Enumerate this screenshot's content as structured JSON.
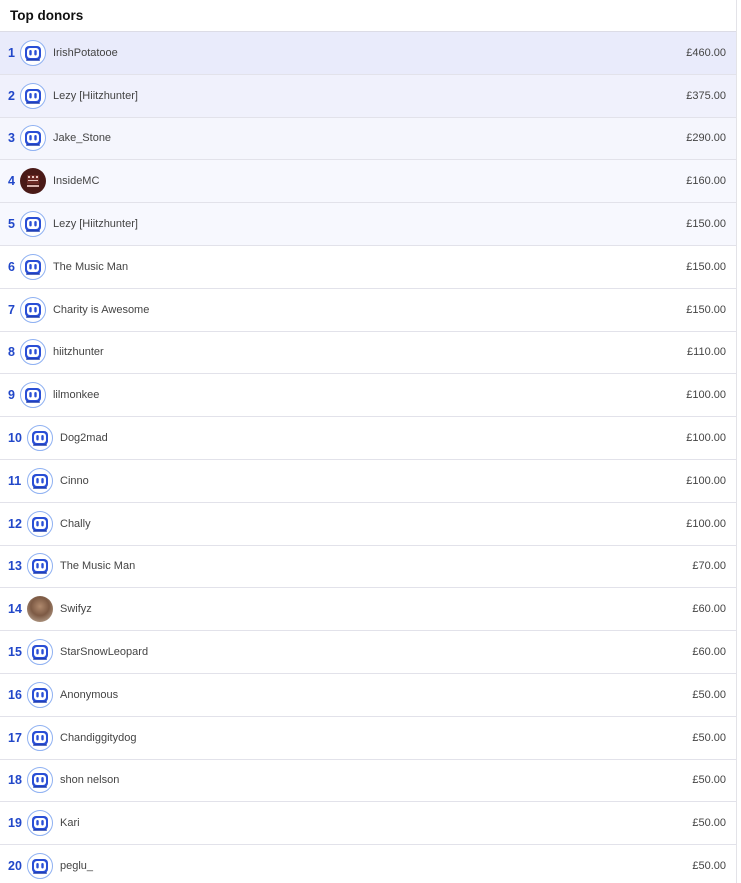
{
  "header": {
    "title": "Top donors"
  },
  "donors": [
    {
      "rank": "1",
      "name": "IrishPotatooe",
      "amount": "£460.00",
      "avatar": "robot-icon"
    },
    {
      "rank": "2",
      "name": "Lezy [Hiitzhunter]",
      "amount": "£375.00",
      "avatar": "robot-icon"
    },
    {
      "rank": "3",
      "name": "Jake_Stone",
      "amount": "£290.00",
      "avatar": "robot-icon"
    },
    {
      "rank": "4",
      "name": "InsideMC",
      "amount": "£160.00",
      "avatar": "pixel-logo-icon"
    },
    {
      "rank": "5",
      "name": "Lezy [Hiitzhunter]",
      "amount": "£150.00",
      "avatar": "robot-icon"
    },
    {
      "rank": "6",
      "name": "The Music Man",
      "amount": "£150.00",
      "avatar": "robot-icon"
    },
    {
      "rank": "7",
      "name": "Charity is Awesome",
      "amount": "£150.00",
      "avatar": "robot-icon"
    },
    {
      "rank": "8",
      "name": "hiitzhunter",
      "amount": "£110.00",
      "avatar": "robot-icon"
    },
    {
      "rank": "9",
      "name": "lilmonkee",
      "amount": "£100.00",
      "avatar": "robot-icon"
    },
    {
      "rank": "10",
      "name": "Dog2mad",
      "amount": "£100.00",
      "avatar": "robot-icon"
    },
    {
      "rank": "11",
      "name": "Cinno",
      "amount": "£100.00",
      "avatar": "robot-icon"
    },
    {
      "rank": "12",
      "name": "Chally",
      "amount": "£100.00",
      "avatar": "robot-icon"
    },
    {
      "rank": "13",
      "name": "The Music Man",
      "amount": "£70.00",
      "avatar": "robot-icon"
    },
    {
      "rank": "14",
      "name": "Swifyz",
      "amount": "£60.00",
      "avatar": "photo-avatar"
    },
    {
      "rank": "15",
      "name": "StarSnowLeopard",
      "amount": "£60.00",
      "avatar": "robot-icon"
    },
    {
      "rank": "16",
      "name": "Anonymous",
      "amount": "£50.00",
      "avatar": "robot-icon"
    },
    {
      "rank": "17",
      "name": "Chandiggitydog",
      "amount": "£50.00",
      "avatar": "robot-icon"
    },
    {
      "rank": "18",
      "name": "shon nelson",
      "amount": "£50.00",
      "avatar": "robot-icon"
    },
    {
      "rank": "19",
      "name": "Kari",
      "amount": "£50.00",
      "avatar": "robot-icon"
    },
    {
      "rank": "20",
      "name": "peglu_",
      "amount": "£50.00",
      "avatar": "robot-icon"
    }
  ],
  "colors": {
    "rank": "#2147c9",
    "highlight_top": "#e9ebfb",
    "avatar_border": "#8fb1f2",
    "robot_face": "#2a4fd6"
  }
}
